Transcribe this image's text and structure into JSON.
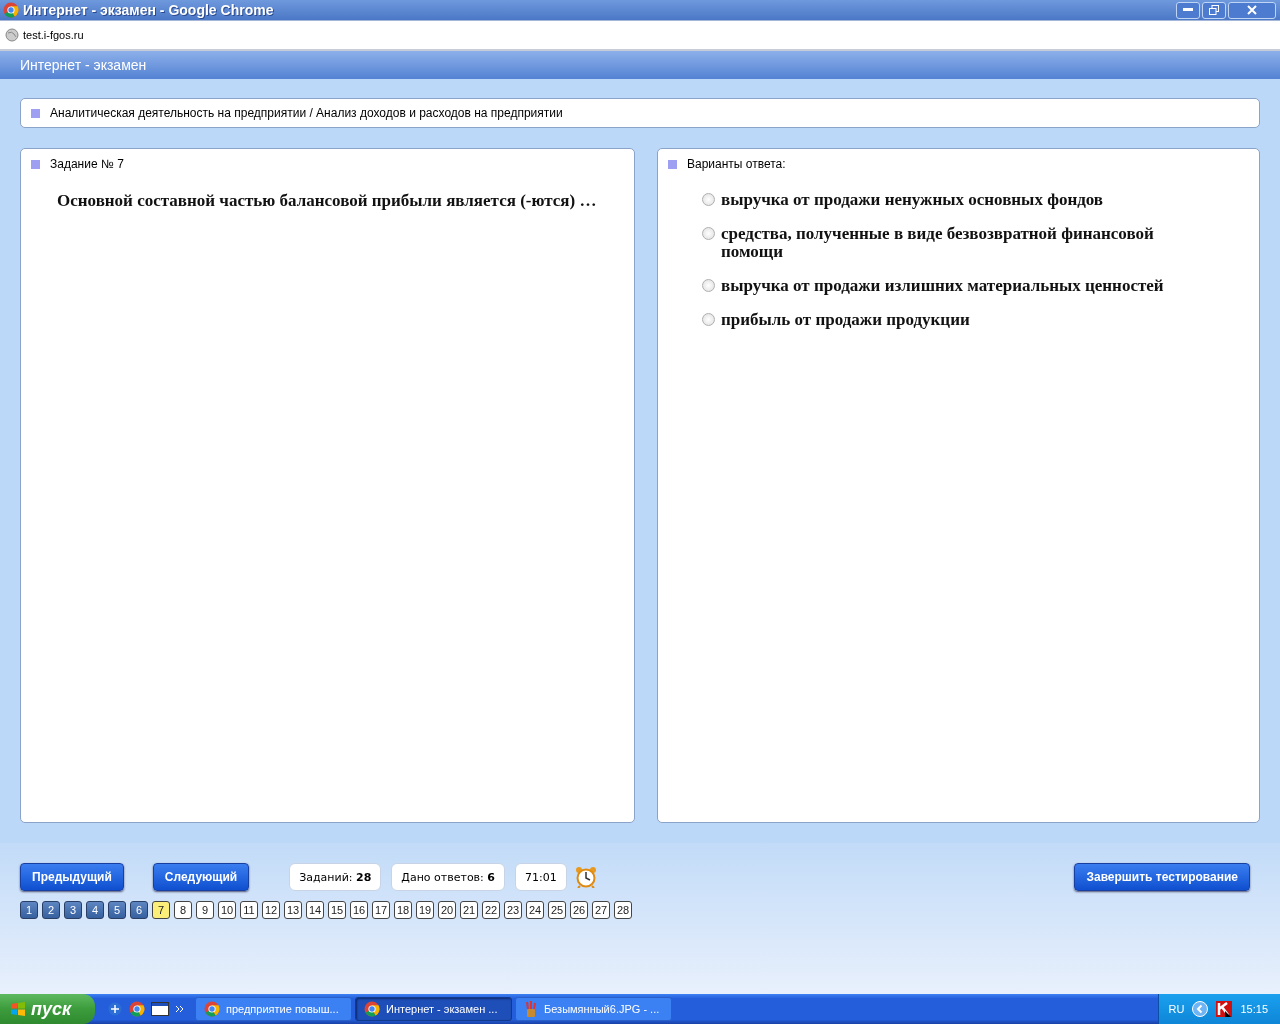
{
  "window": {
    "title": "Интернет - экзамен - Google Chrome",
    "url": "test.i-fgos.ru"
  },
  "app": {
    "title": "Интернет - экзамен"
  },
  "breadcrumb": "Аналитическая деятельность на предприятии / Анализ доходов и расходов на предприятии",
  "question": {
    "heading": "Задание № 7",
    "text": "Основной составной частью балансовой прибыли является (-ются) …"
  },
  "answers": {
    "heading": "Варианты ответа:",
    "options": [
      {
        "text": "выручка от продажи ненужных основных фондов",
        "selected": false
      },
      {
        "text": "средства, полученные в виде безвозвратной финансовой помощи",
        "selected": false
      },
      {
        "text": "выручка от продажи излишних материальных ценностей",
        "selected": false
      },
      {
        "text": "прибыль от продажи продукции",
        "selected": false
      }
    ]
  },
  "nav": {
    "prev": "Предыдущий",
    "next": "Следующий",
    "finish": "Завершить тестирование"
  },
  "stats": [
    {
      "text": "Заданий: **28**"
    },
    {
      "text": "Дано ответов: **6**"
    },
    {
      "text": "71:01"
    }
  ],
  "pages": [
    {
      "label": "1",
      "answered": true,
      "selected": false
    },
    {
      "label": "2",
      "answered": true,
      "selected": false
    },
    {
      "label": "3",
      "answered": true,
      "selected": false
    },
    {
      "label": "4",
      "answered": true,
      "selected": false
    },
    {
      "label": "5",
      "answered": true,
      "selected": false
    },
    {
      "label": "6",
      "answered": true,
      "selected": false
    },
    {
      "label": "7",
      "answered": false,
      "selected": true
    },
    {
      "label": "8",
      "answered": false,
      "selected": false
    },
    {
      "label": "9",
      "answered": false,
      "selected": false
    },
    {
      "label": "10",
      "answered": false,
      "selected": false
    },
    {
      "label": "11",
      "answered": false,
      "selected": false
    },
    {
      "label": "12",
      "answered": false,
      "selected": false
    },
    {
      "label": "13",
      "answered": false,
      "selected": false
    },
    {
      "label": "14",
      "answered": false,
      "selected": false
    },
    {
      "label": "15",
      "answered": false,
      "selected": false
    },
    {
      "label": "16",
      "answered": false,
      "selected": false
    },
    {
      "label": "17",
      "answered": false,
      "selected": false
    },
    {
      "label": "18",
      "answered": false,
      "selected": false
    },
    {
      "label": "19",
      "answered": false,
      "selected": false
    },
    {
      "label": "20",
      "answered": false,
      "selected": false
    },
    {
      "label": "21",
      "answered": false,
      "selected": false
    },
    {
      "label": "22",
      "answered": false,
      "selected": false
    },
    {
      "label": "23",
      "answered": false,
      "selected": false
    },
    {
      "label": "24",
      "answered": false,
      "selected": false
    },
    {
      "label": "25",
      "answered": false,
      "selected": false
    },
    {
      "label": "26",
      "answered": false,
      "selected": false
    },
    {
      "label": "27",
      "answered": false,
      "selected": false
    },
    {
      "label": "28",
      "answered": false,
      "selected": false
    }
  ],
  "taskbar": {
    "start": "пуск",
    "windows": [
      {
        "label": "предприятие повыш...",
        "kind": "chrome",
        "selected": false
      },
      {
        "label": "Интернет - экзамен ...",
        "kind": "chrome",
        "selected": true
      },
      {
        "label": "Безымянный6.JPG - ...",
        "kind": "paint",
        "selected": false
      }
    ],
    "language": "RU",
    "clock": "15:15"
  }
}
